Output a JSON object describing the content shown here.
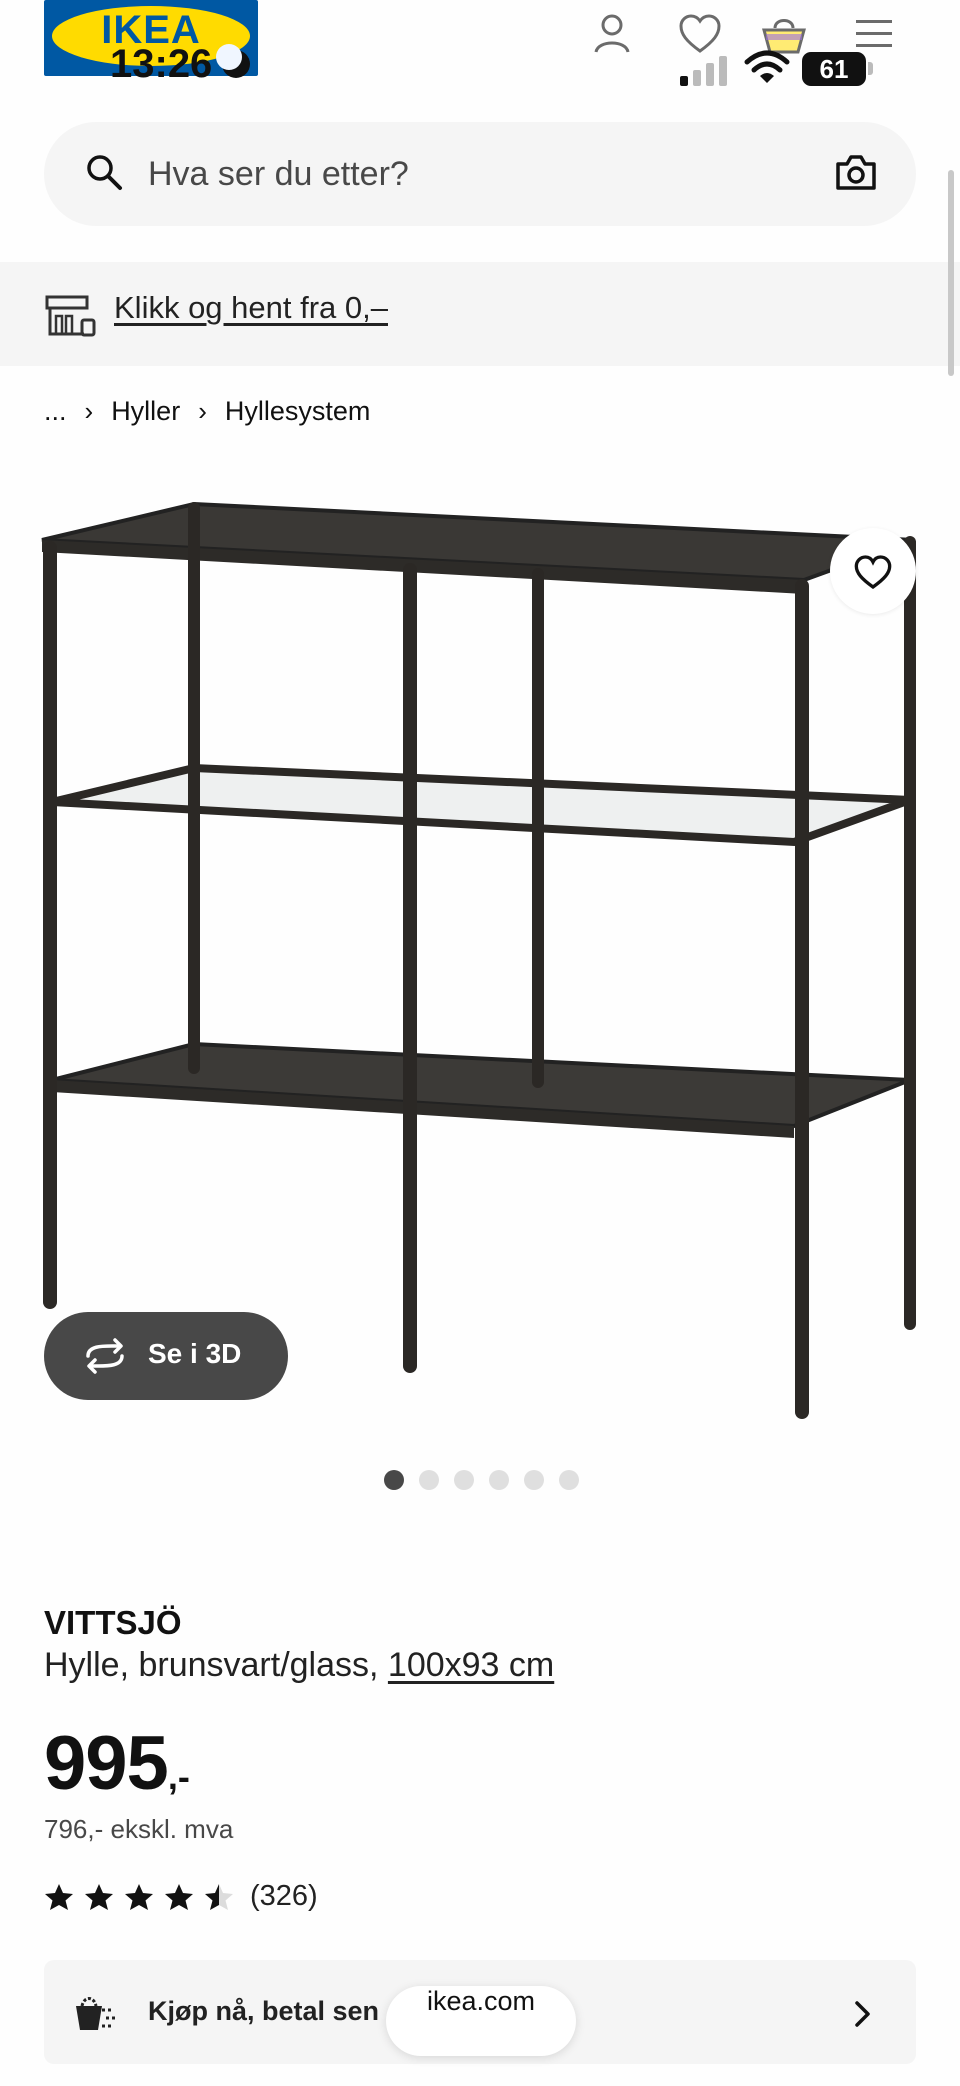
{
  "status_bar": {
    "time": "13:26",
    "battery": "61"
  },
  "header": {
    "logo_text": "IKEA"
  },
  "search": {
    "placeholder": "Hva ser du etter?"
  },
  "promo": {
    "text": "Klikk og hent fra 0,–"
  },
  "breadcrumb": {
    "ellipsis": "...",
    "items": [
      "Hyller",
      "Hyllesystem"
    ]
  },
  "gallery": {
    "view_3d_label": "Se i 3D",
    "image_count": 6,
    "active_index": 0
  },
  "product": {
    "name": "VITTSJÖ",
    "description": "Hylle, brunsvart/glass, ",
    "size": "100x93 cm",
    "price": "995",
    "price_suffix": ",-",
    "price_ex_vat": "796,- ekskl. mva",
    "rating": 4.5,
    "rating_max": 5,
    "review_count": "(326)"
  },
  "banner": {
    "text": "Kjøp nå, betal sen"
  },
  "browser": {
    "url": "ikea.com"
  },
  "colors": {
    "brand_blue": "#0058a3",
    "brand_yellow": "#ffdb00",
    "dark_gray": "#484848",
    "light_gray": "#f5f5f5"
  }
}
